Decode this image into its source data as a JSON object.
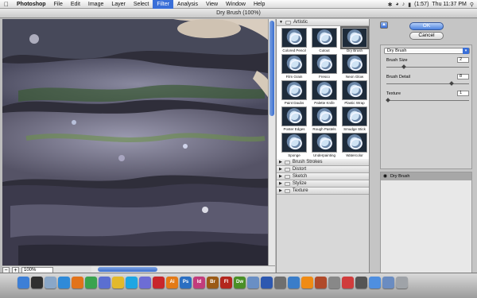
{
  "menubar": {
    "app": "Photoshop",
    "items": [
      "File",
      "Edit",
      "Image",
      "Layer",
      "Select",
      "Filter",
      "Analysis",
      "View",
      "Window",
      "Help"
    ],
    "active_index": 5,
    "battery": "(1:57)",
    "clock": "Thu 11:37 PM",
    "icons": [
      "apple-icon",
      "bluetooth-icon",
      "wifi-icon",
      "volume-icon",
      "battery-icon",
      "spotlight-icon"
    ]
  },
  "window": {
    "title": "Dry Brush (100%)"
  },
  "preview": {
    "zoom": "100%"
  },
  "gallery": {
    "artistic": {
      "label": "Artistic",
      "filters": [
        "Colored Pencil",
        "Cutout",
        "Dry Brush",
        "Film Grain",
        "Fresco",
        "Neon Glow",
        "Paint Daubs",
        "Palette Knife",
        "Plastic Wrap",
        "Poster Edges",
        "Rough Pastels",
        "Smudge Stick",
        "Sponge",
        "Underpainting",
        "Watercolor"
      ],
      "selected_index": 2
    },
    "categories": [
      "Brush Strokes",
      "Distort",
      "Sketch",
      "Stylize",
      "Texture"
    ]
  },
  "buttons": {
    "ok": "OK",
    "cancel": "Cancel"
  },
  "settings": {
    "filter": "Dry Brush",
    "params": [
      {
        "label": "Brush Size",
        "value": "2",
        "fraction": 0.2
      },
      {
        "label": "Brush Detail",
        "value": "8",
        "fraction": 0.8
      },
      {
        "label": "Texture",
        "value": "1",
        "fraction": 0.0
      }
    ]
  },
  "layers": {
    "items": [
      "Dry Brush"
    ]
  },
  "dock": {
    "icons": [
      {
        "name": "finder-icon",
        "label": "",
        "color": "#3d7fd6"
      },
      {
        "name": "dashboard-icon",
        "label": "",
        "color": "#303030"
      },
      {
        "name": "mail-icon",
        "label": "",
        "color": "#8aa7c8"
      },
      {
        "name": "safari-icon",
        "label": "",
        "color": "#2f8ad8"
      },
      {
        "name": "firefox-icon",
        "label": "",
        "color": "#e2731a"
      },
      {
        "name": "chrome-icon",
        "label": "",
        "color": "#3aa34f"
      },
      {
        "name": "itunes-icon",
        "label": "",
        "color": "#5b6fd1"
      },
      {
        "name": "adium-icon",
        "label": "",
        "color": "#e3b92b"
      },
      {
        "name": "skype-icon",
        "label": "",
        "color": "#1ea6e3"
      },
      {
        "name": "itunes-music-icon",
        "label": "",
        "color": "#6d6dd5"
      },
      {
        "name": "acrobat-icon",
        "label": "",
        "color": "#c8262b"
      },
      {
        "name": "illustrator-icon",
        "label": "Ai",
        "color": "#e37a17"
      },
      {
        "name": "photoshop-icon",
        "label": "Ps",
        "color": "#2b6fc2"
      },
      {
        "name": "indesign-icon",
        "label": "Id",
        "color": "#c23c7c"
      },
      {
        "name": "bridge-icon",
        "label": "Br",
        "color": "#9b5a16"
      },
      {
        "name": "flash-icon",
        "label": "Fl",
        "color": "#b3261e"
      },
      {
        "name": "dreamweaver-icon",
        "label": "Dw",
        "color": "#4a8f26"
      },
      {
        "name": "iphoto-icon",
        "label": "",
        "color": "#6a8fc4"
      },
      {
        "name": "word-icon",
        "label": "",
        "color": "#2d58b0"
      },
      {
        "name": "preview-icon",
        "label": "",
        "color": "#6f6f6f"
      },
      {
        "name": "itunes-store-icon",
        "label": "",
        "color": "#3a7dc9"
      },
      {
        "name": "vlc-icon",
        "label": "",
        "color": "#ef8b14"
      },
      {
        "name": "handbrake-icon",
        "label": "",
        "color": "#b04a2a"
      },
      {
        "name": "utility-icon",
        "label": "",
        "color": "#888888"
      },
      {
        "name": "calendar-icon",
        "label": "",
        "color": "#d03c3c"
      },
      {
        "name": "migration-icon",
        "label": "",
        "color": "#555555"
      },
      {
        "name": "app-store-icon",
        "label": "",
        "color": "#4f8fe0"
      },
      {
        "name": "downloads-icon",
        "label": "",
        "color": "#6a8cc1"
      },
      {
        "name": "trash-icon",
        "label": "",
        "color": "#9fa3a8"
      }
    ]
  }
}
